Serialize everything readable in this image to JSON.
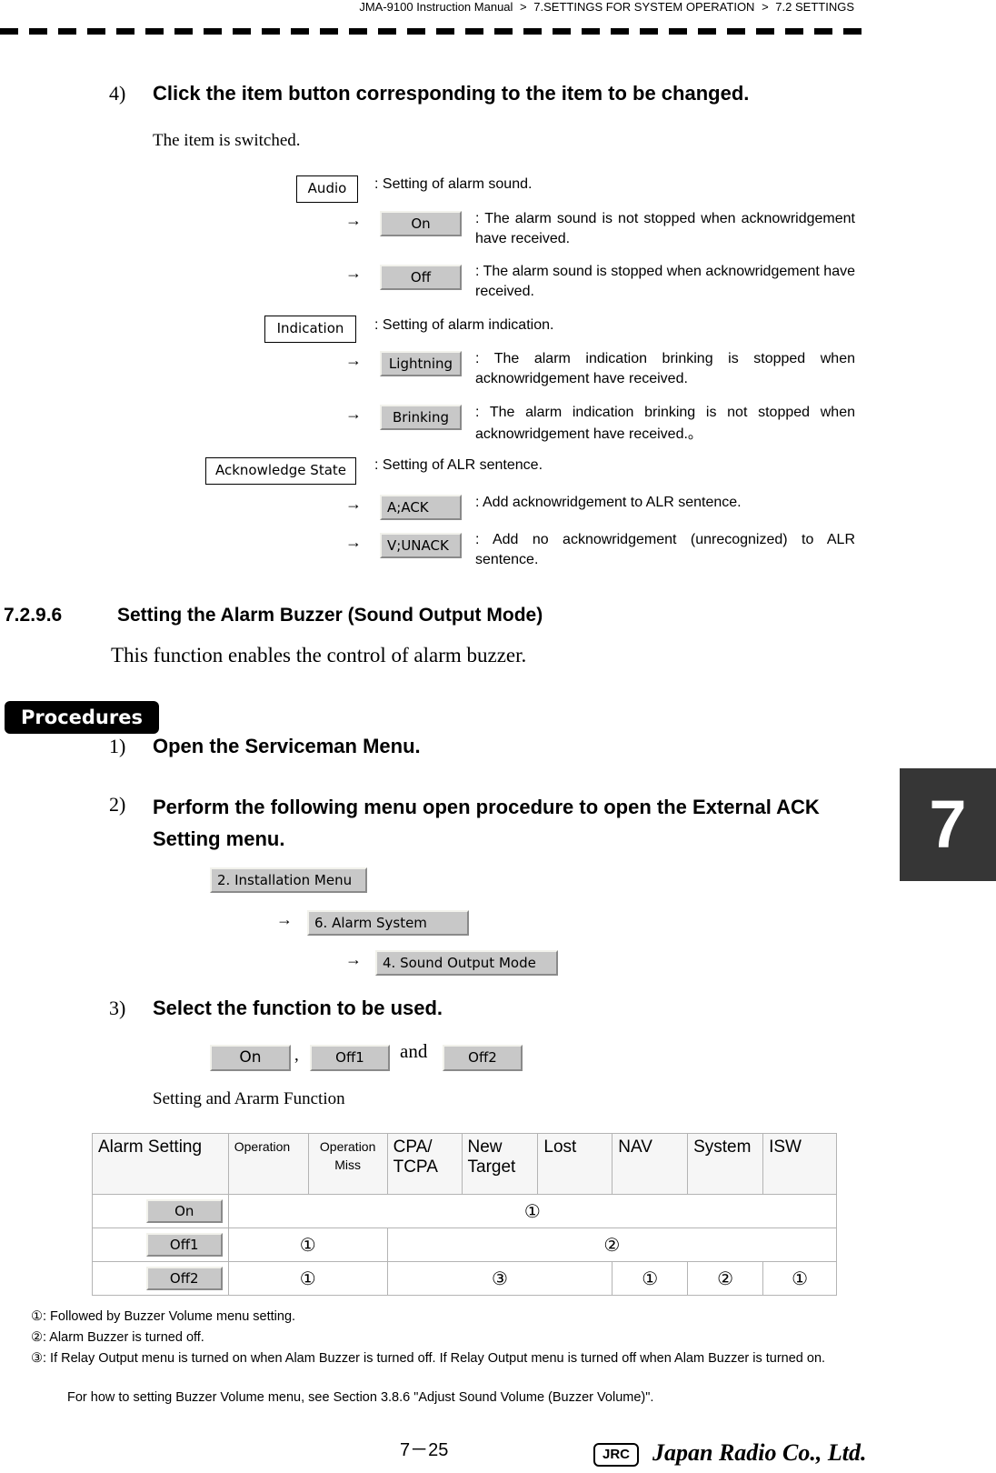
{
  "header": {
    "crumbs": [
      "JMA-9100 Instruction Manual",
      "7.SETTINGS FOR SYSTEM OPERATION",
      "7.2  SETTINGS"
    ],
    "separator": ">"
  },
  "step4": {
    "num": "4)",
    "text": "Click the item button corresponding to the item to be changed.",
    "sub": "The item is switched."
  },
  "items": {
    "audio": {
      "label": "Audio",
      "desc": ": Setting of alarm sound.",
      "options": [
        {
          "label": "On",
          "desc": ": The alarm sound is not stopped when acknowridgement have received."
        },
        {
          "label": "Off",
          "desc": ": The alarm sound is stopped when acknowridgement have received."
        }
      ]
    },
    "indication": {
      "label": "Indication",
      "desc": ": Setting of alarm indication.",
      "options": [
        {
          "label": "Lightning",
          "desc": ": The alarm indication brinking is stopped when acknowridgement have received."
        },
        {
          "label": "Brinking",
          "desc": ": The alarm indication brinking is not stopped when acknowridgement have received.。"
        }
      ]
    },
    "ack_state": {
      "label": "Acknowledge State",
      "desc": ": Setting of ALR sentence.",
      "options": [
        {
          "label": "A;ACK",
          "desc": ": Add acknowridgement to ALR sentence."
        },
        {
          "label": "V;UNACK",
          "desc": ": Add no acknowridgement (unrecognized) to ALR sentence."
        }
      ]
    },
    "arrow": "→"
  },
  "section": {
    "number": "7.2.9.6",
    "title": "Setting the Alarm Buzzer (Sound Output Mode)",
    "intro": "This function enables the control of alarm buzzer."
  },
  "procedures_label": "Procedures",
  "steps": [
    {
      "num": "1)",
      "text": "Open the Serviceman Menu."
    },
    {
      "num": "2)",
      "text": "Perform the following menu open procedure to open the External ACK Setting menu."
    },
    {
      "num": "3)",
      "text": "Select the function to be used."
    }
  ],
  "menu_path": [
    "2. Installation Menu",
    "6. Alarm System",
    "4. Sound Output Mode"
  ],
  "function_buttons": {
    "on": "On",
    "off1": "Off1",
    "off2": "Off2",
    "comma": ",",
    "and": "and"
  },
  "table": {
    "caption": "Setting and Ararm Function",
    "headers": [
      "Alarm Setting",
      "Operation",
      "Operation Miss",
      "CPA/ TCPA",
      "New Target",
      "Lost",
      "NAV",
      "System",
      "ISW"
    ],
    "rows": [
      {
        "setting": "On",
        "cells": [
          {
            "value": "①",
            "span": 8
          }
        ]
      },
      {
        "setting": "Off1",
        "cells": [
          {
            "value": "①",
            "span": 2
          },
          {
            "value": "②",
            "span": 6
          }
        ]
      },
      {
        "setting": "Off2",
        "cells": [
          {
            "value": "①",
            "span": 2
          },
          {
            "value": "③",
            "span": 3
          },
          {
            "value": "①",
            "span": 1
          },
          {
            "value": "②",
            "span": 1
          },
          {
            "value": "①",
            "span": 1
          }
        ]
      }
    ]
  },
  "notes": [
    "①: Followed by Buzzer Volume menu setting.",
    "②: Alarm Buzzer is turned off.",
    "③: If Relay Output menu is turned on when Alam Buzzer is turned off. If Relay Output menu is turned off when Alam Buzzer is turned on.",
    "For how to setting Buzzer Volume menu, see Section 3.8.6 \"Adjust Sound Volume (Buzzer Volume)\"."
  ],
  "chapter_tab": "7",
  "footer": {
    "page": "7－25",
    "logo": "JRC",
    "brand": "Japan Radio Co., Ltd."
  }
}
